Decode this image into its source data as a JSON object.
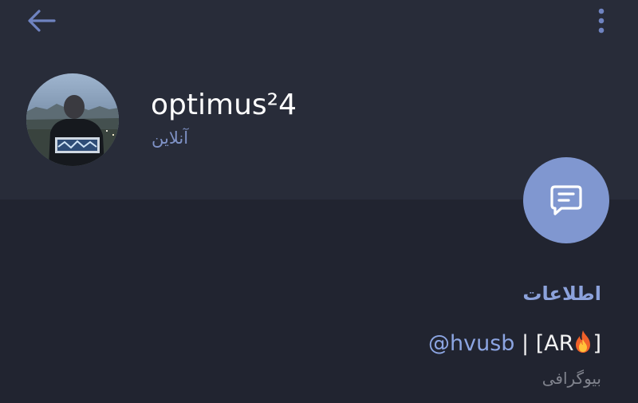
{
  "header": {
    "back_icon": "arrow-left-icon",
    "menu_icon": "more-vertical-icon",
    "profile_name": "optimus²4",
    "status": "آنلاین",
    "message_icon": "chat-bubble-icon"
  },
  "info": {
    "section_title": "اطلاعات",
    "bio": {
      "mention": "@hvusb",
      "separator": " | ",
      "tag_open": "[AR",
      "tag_icon": "fire-emoji",
      "tag_close": "]",
      "label": "بیوگرافی"
    }
  },
  "colors": {
    "background": "#212430",
    "header_background": "#282c39",
    "accent": "#8097d0",
    "link": "#8ca5e2",
    "status_text": "#7f92c6",
    "secondary_text": "#80838d"
  }
}
